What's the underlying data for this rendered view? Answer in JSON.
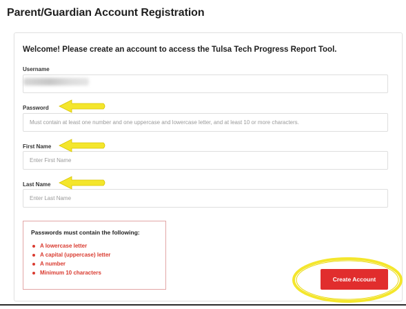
{
  "page": {
    "title": "Parent/Guardian Account Registration"
  },
  "form": {
    "welcome": "Welcome! Please create an account to access the Tulsa Tech Progress Report Tool.",
    "username": {
      "label": "Username",
      "value": ""
    },
    "password": {
      "label": "Password",
      "placeholder": "Must contain at least one number and one uppercase and lowercase letter, and at least 10 or more characters."
    },
    "first_name": {
      "label": "First Name",
      "placeholder": "Enter First Name"
    },
    "last_name": {
      "label": "Last Name",
      "placeholder": "Enter Last Name"
    },
    "rules": {
      "title": "Passwords must contain the following:",
      "items": [
        "A lowercase letter",
        "A capital (uppercase) letter",
        "A number",
        "Minimum 10 characters"
      ]
    },
    "submit_label": "Create Account"
  },
  "colors": {
    "accent_red": "#e12d2d",
    "rule_red": "#d93a2f",
    "annotation_yellow": "#f4e62c"
  },
  "annotations": {
    "arrow_icon": "yellow-left-arrow",
    "highlight_shape": "yellow-ellipse"
  }
}
